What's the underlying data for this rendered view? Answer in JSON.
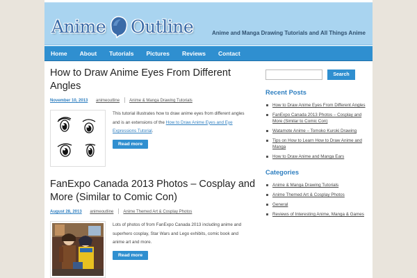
{
  "site": {
    "name_part1": "Anime",
    "name_part2": "Outline",
    "tagline": "Anime and Manga Drawing Tutorials and All Things Anime"
  },
  "nav": {
    "items": [
      {
        "label": "Home"
      },
      {
        "label": "About"
      },
      {
        "label": "Tutorials"
      },
      {
        "label": "Pictures"
      },
      {
        "label": "Reviews"
      },
      {
        "label": "Contact"
      }
    ]
  },
  "posts": [
    {
      "title": "How to Draw Anime Eyes From Different Angles",
      "date": "November 10, 2013",
      "author": "animeoutline",
      "category": "Anime & Manga Drawing Tutorials",
      "excerpt_text": "This tutorial illustrates how to draw anime eyes from different angles and is an extensions of the ",
      "excerpt_link": "How to Draw Anime Eyes and Eye Expressions Tutorial",
      "excerpt_end": ".",
      "read_more": "Read more"
    },
    {
      "title": "FanExpo Canada 2013 Photos – Cosplay and More (Similar to Comic Con)",
      "date": "August 28, 2013",
      "author": "animeoutline",
      "category": "Anime Themed Art & Cosplay Photos",
      "excerpt_text": "Lots of photos of from FanExpo Canada 2013 including anime and superhero cosplay, Star Wars and Lego exhibits, comic book and anime art and more.",
      "read_more": "Read more"
    }
  ],
  "sidebar": {
    "search_button": "Search",
    "search_placeholder": "",
    "recent_title": "Recent Posts",
    "recent": [
      "How to Draw Anime Eyes From Different Angles",
      "FanExpo Canada 2013 Photos – Cosplay and More (Similar to Comic Con)",
      "Watamote Anime – Tomoko Kuroki Drawing",
      "Tips on How to Learn How to Draw Anime and Manga",
      "How to Draw Anime and Manga Ears"
    ],
    "categories_title": "Categories",
    "categories": [
      "Anime & Manga Drawing Tutorials",
      "Anime Themed Art & Cosplay Photos",
      "General",
      "Reviews of Interesting Anime, Manga & Games"
    ]
  },
  "colors": {
    "accent": "#2f8fd0",
    "header_bg": "#a9d4f0",
    "page_bg": "#e9e4dc"
  }
}
